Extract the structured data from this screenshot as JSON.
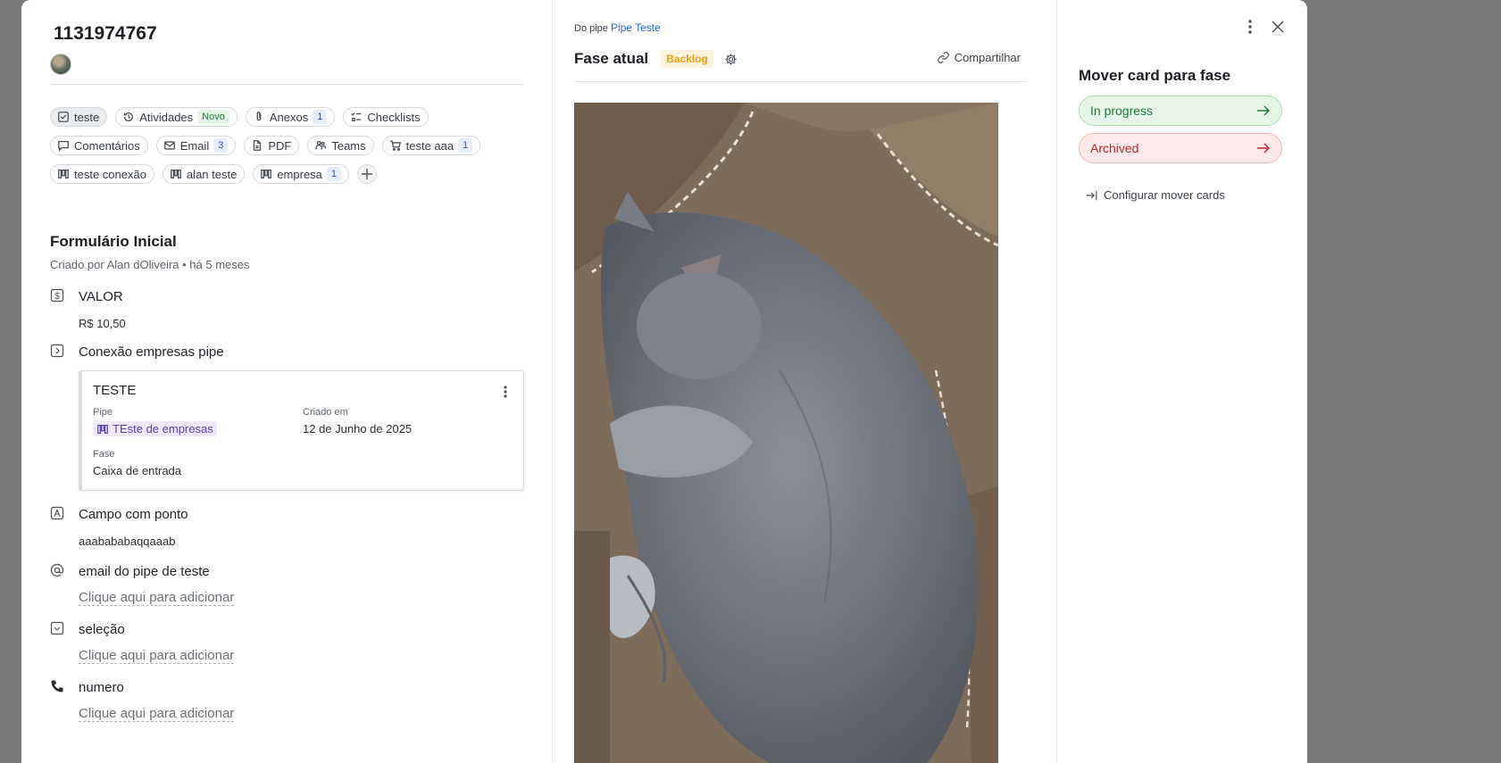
{
  "card": {
    "id": "1131974767"
  },
  "tabs": [
    {
      "label": "teste",
      "icon": "checkbox-icon",
      "active": true
    },
    {
      "label": "Atividades",
      "icon": "history-icon",
      "badge": "Novo"
    },
    {
      "label": "Anexos",
      "icon": "paperclip-icon",
      "count": "1"
    },
    {
      "label": "Checklists",
      "icon": "checklist-icon"
    },
    {
      "label": "Comentários",
      "icon": "comment-icon"
    },
    {
      "label": "Email",
      "icon": "mail-icon",
      "count": "3"
    },
    {
      "label": "PDF",
      "icon": "document-icon"
    },
    {
      "label": "Teams",
      "icon": "teams-icon"
    },
    {
      "label": "teste aaa",
      "icon": "cart-icon",
      "count": "1"
    },
    {
      "label": "teste conexão",
      "icon": "pipe-icon"
    },
    {
      "label": "alan teste",
      "icon": "pipe-icon"
    },
    {
      "label": "empresa",
      "icon": "pipe-icon",
      "count": "1"
    }
  ],
  "form": {
    "title": "Formulário Inicial",
    "subtitle": "Criado por Alan dOliveira • há 5 meses",
    "valor_label": "VALOR",
    "valor_value": "R$ 10,50",
    "conexao_label": "Conexão empresas pipe",
    "connected_card": {
      "title": "TESTE",
      "pipe_label": "Pipe",
      "pipe_value": "TEste de empresas",
      "created_label": "Criado em",
      "created_value": "12 de Junho de 2025",
      "phase_label": "Fase",
      "phase_value": "Caixa de entrada"
    },
    "campo_label": "Campo com ponto",
    "campo_value": "aaabababaqqaaab",
    "email_label": "email do pipe de teste",
    "email_add": "Clique aqui para adicionar",
    "selecao_label": "seleção",
    "selecao_add": "Clique aqui para adicionar",
    "numero_label": "numero",
    "numero_add": "Clique aqui para adicionar"
  },
  "middle": {
    "do_pipe": "Do pipe",
    "pipe_name": "Pipe Teste",
    "phase_title": "Fase atual",
    "phase_badge": "Backlog",
    "share_label": "Compartilhar"
  },
  "right": {
    "title": "Mover card para fase",
    "phases": [
      {
        "label": "In progress",
        "color": "#1f7a35"
      },
      {
        "label": "Archived",
        "color": "#c0262f"
      }
    ],
    "config_label": "Configurar mover cards"
  },
  "colors": {
    "accent_link": "#2764d6",
    "backlog": "#e4a217"
  }
}
